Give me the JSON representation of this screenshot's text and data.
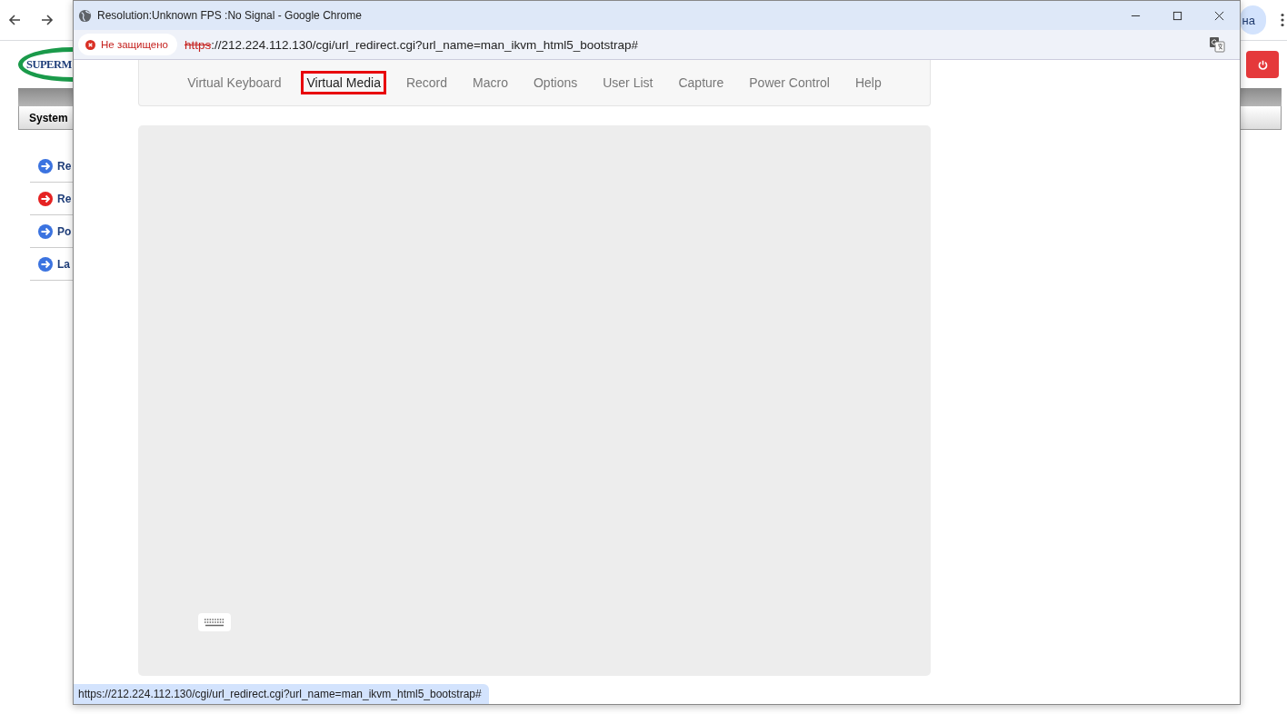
{
  "page": {
    "logo": "SUPERM",
    "account_chip": "на",
    "section_tab": "System",
    "menu": [
      {
        "label": "Re",
        "color": "#3b73e0"
      },
      {
        "label": "Re",
        "color": "#e52222"
      },
      {
        "label": "Po",
        "color": "#3b73e0"
      },
      {
        "label": "La",
        "color": "#3b73e0"
      }
    ]
  },
  "window": {
    "title": "Resolution:Unknown FPS :No Signal - Google Chrome",
    "security": "Не защищено",
    "url_scheme": "https",
    "url_rest": "://212.224.112.130/cgi/url_redirect.cgi?url_name=man_ikvm_html5_bootstrap#",
    "tabs": [
      {
        "label": "Virtual Keyboard",
        "selected": false
      },
      {
        "label": "Virtual Media",
        "selected": true
      },
      {
        "label": "Record",
        "selected": false
      },
      {
        "label": "Macro",
        "selected": false
      },
      {
        "label": "Options",
        "selected": false
      },
      {
        "label": "User List",
        "selected": false
      },
      {
        "label": "Capture",
        "selected": false
      },
      {
        "label": "Power Control",
        "selected": false
      },
      {
        "label": "Help",
        "selected": false
      }
    ],
    "status_url": "https://212.224.112.130/cgi/url_redirect.cgi?url_name=man_ikvm_html5_bootstrap#"
  }
}
